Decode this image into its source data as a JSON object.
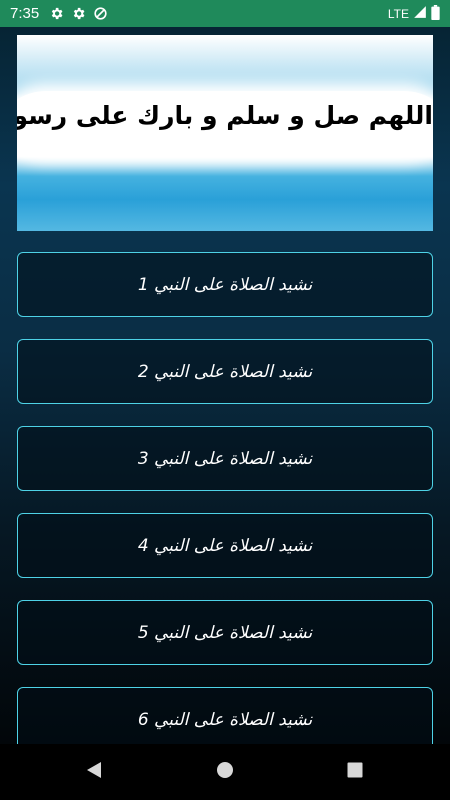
{
  "status_bar": {
    "time": "7:35",
    "network": "LTE",
    "icons": [
      "settings-gear-icon",
      "settings-gear-icon",
      "do-not-disturb-icon",
      "signal-icon",
      "battery-icon"
    ]
  },
  "banner": {
    "text": "اللهم صل و سلم و بارك على رسولك محمد"
  },
  "list": {
    "items": [
      {
        "label": "نشيد الصلاة على النبي  1"
      },
      {
        "label": "نشيد الصلاة على النبي  2"
      },
      {
        "label": "نشيد الصلاة على النبي  3"
      },
      {
        "label": "نشيد الصلاة على النبي  4"
      },
      {
        "label": "نشيد الصلاة على النبي  5"
      },
      {
        "label": "نشيد الصلاة على النبي  6"
      }
    ]
  },
  "nav_bar": {
    "icons": [
      "back-icon",
      "home-icon",
      "recents-icon"
    ]
  },
  "colors": {
    "status_bar": "#1f8a5b",
    "item_border": "#4ed2e6",
    "background_top": "#0a3550",
    "background_bottom": "#020609"
  }
}
